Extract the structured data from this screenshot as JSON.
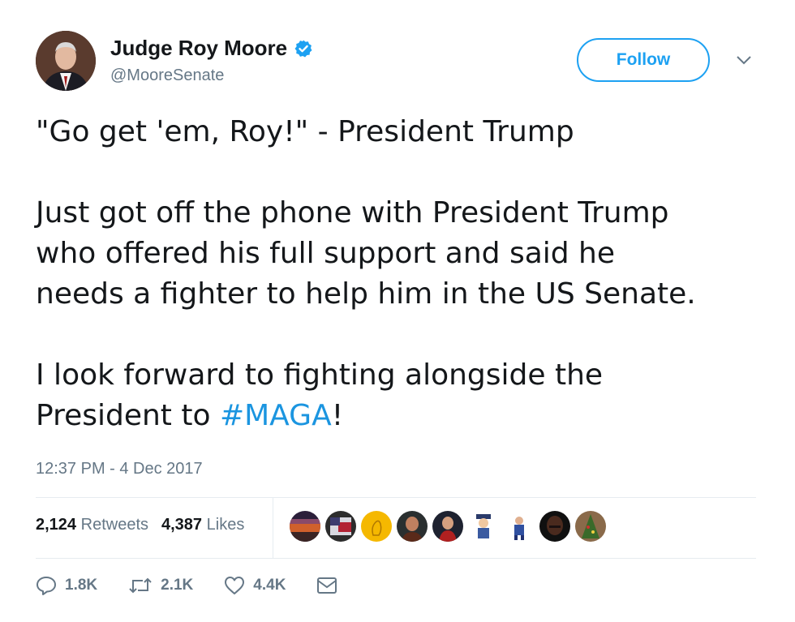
{
  "author": {
    "display_name": "Judge Roy Moore",
    "handle": "@MooreSenate",
    "verified": true,
    "avatar_icon": "profile-photo"
  },
  "follow_button": {
    "label": "Follow"
  },
  "tweet": {
    "line1": "\"Go get 'em, Roy!\" - President Trump",
    "para2_line1": "Just got off the phone with President Trump",
    "para2_line2": "who offered his full support and said he",
    "para2_line3": "needs a fighter to help him in the US Senate.",
    "para3_line1": "I look forward to fighting alongside the",
    "para3_line2_prefix": "President to ",
    "hashtag": "#MAGA",
    "para3_line2_suffix": "!"
  },
  "timestamp": "12:37 PM - 4 Dec 2017",
  "stats": {
    "retweets_count": "2,124",
    "retweets_label": "Retweets",
    "likes_count": "4,387",
    "likes_label": "Likes"
  },
  "liker_avatars": [
    "avatar-1",
    "avatar-2",
    "avatar-3",
    "avatar-4",
    "avatar-5",
    "avatar-6",
    "avatar-7",
    "avatar-8",
    "avatar-9"
  ],
  "actions": {
    "reply_count": "1.8K",
    "retweet_count": "2.1K",
    "like_count": "4.4K"
  },
  "colors": {
    "accent": "#1da1f2",
    "hashtag": "#1b95e0",
    "secondary_text": "#657786",
    "divider": "#e6ecf0"
  }
}
